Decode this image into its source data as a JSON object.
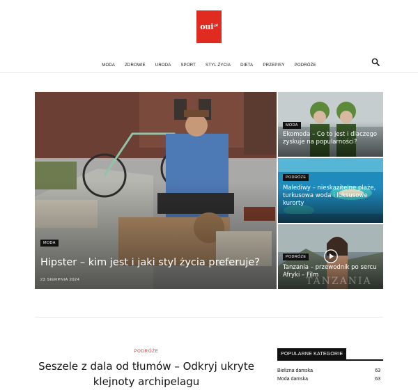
{
  "brand": {
    "logo_text": "oui",
    "logo_suffix": ".pl",
    "color": "#e02b20"
  },
  "nav": {
    "items": [
      "MODA",
      "ZDROWIE",
      "URODA",
      "SPORT",
      "STYL ŻYCIA",
      "DIETA",
      "PRZEPISY",
      "PODRÓŻE"
    ],
    "search_icon": "search-icon"
  },
  "featured": {
    "main": {
      "category": "MODA",
      "title": "Hipster – kim jest i jaki styl życia preferuje?",
      "date": "23 sierpnia 2024"
    },
    "side": [
      {
        "category": "MODA",
        "title": "Ekomoda – Co to jest i dlaczego zyskuje na popularności?"
      },
      {
        "category": "PODRÓŻE",
        "title": "Malediwy – nieskazitelne plaże, turkusowa woda i luksusowe kurorty"
      },
      {
        "category": "PODRÓŻE",
        "title": "Tanzania – przewodnik po sercu Afryki – Film",
        "watermark": "TANZANIA"
      }
    ]
  },
  "article": {
    "category": "PODRÓŻE",
    "title": "Seszele z dala od tłumów – Odkryj ukryte klejnoty archipelagu"
  },
  "sidebar": {
    "title": "POPULARNE KATEGORIE",
    "items": [
      {
        "label": "Bielizna damska",
        "count": "63"
      },
      {
        "label": "Moda damska",
        "count": "63"
      }
    ]
  }
}
